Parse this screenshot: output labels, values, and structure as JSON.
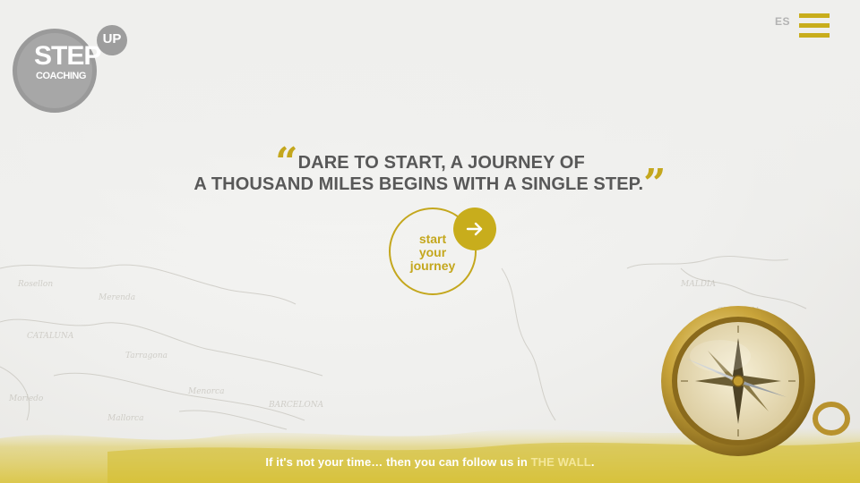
{
  "header": {
    "logo": {
      "step": "STEP",
      "coaching": "COACHING",
      "up": "UP"
    },
    "language_label": "ES",
    "menu_icon": "hamburger-menu-icon"
  },
  "hero": {
    "quote_line_1": "DARE TO START, A JOURNEY OF",
    "quote_line_2": "A THOUSAND MILES BEGINS WITH A SINGLE STEP.",
    "quote_open": "“",
    "quote_close": "”",
    "cta_label_1": "start",
    "cta_label_2": "your",
    "cta_label_3": "journey",
    "cta_icon": "arrow-right-icon"
  },
  "footer": {
    "text": "If it's not your time… then you can follow us in ",
    "link_label": "THE WALL",
    "text_end": "."
  },
  "colors": {
    "accent": "#c8ad1c",
    "text_dark": "#585858",
    "logo_gray": "#a7a7a7"
  }
}
